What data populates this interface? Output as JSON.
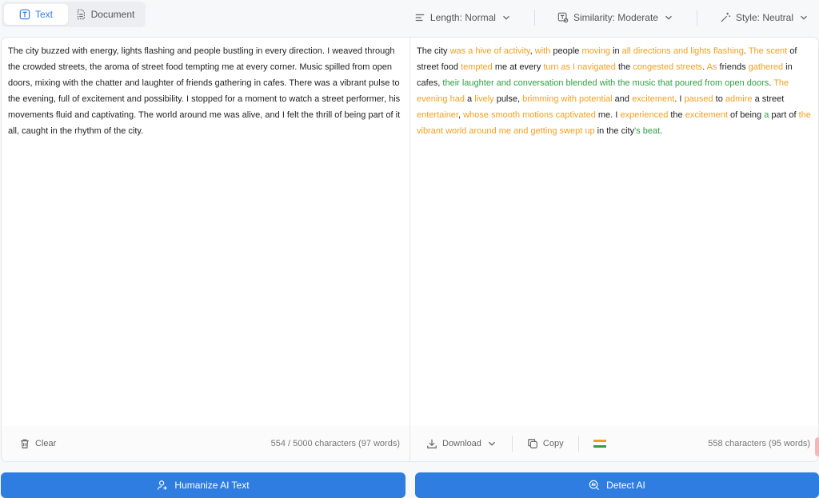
{
  "tabs": [
    {
      "label": "Text",
      "icon": "text-icon",
      "active": true
    },
    {
      "label": "Document",
      "icon": "document-icon",
      "active": false
    }
  ],
  "settings": {
    "length": "Length: Normal",
    "similarity": "Similarity: Moderate",
    "style": "Style: Neutral"
  },
  "input": {
    "text": "The city buzzed with energy, lights flashing and people bustling in every direction. I weaved through the crowded streets, the aroma of street food tempting me at every corner. Music spilled from open doors, mixing with the chatter and laughter of friends gathering in cafes. There was a vibrant pulse to the evening, full of excitement and possibility. I stopped for a moment to watch a street performer, his movements fluid and captivating. The world around me was alive, and I felt the thrill of being part of it all, caught in the rhythm of the city.",
    "clear_label": "Clear",
    "count": "554 / 5000 characters (97 words)"
  },
  "output": {
    "segments": [
      {
        "t": "The city ",
        "c": "plain"
      },
      {
        "t": "was a hive of activity",
        "c": "orange"
      },
      {
        "t": ", ",
        "c": "plain"
      },
      {
        "t": "with",
        "c": "orange"
      },
      {
        "t": " people ",
        "c": "plain"
      },
      {
        "t": "moving",
        "c": "orange"
      },
      {
        "t": " in ",
        "c": "plain"
      },
      {
        "t": "all directions and lights flashing",
        "c": "orange"
      },
      {
        "t": ". ",
        "c": "plain"
      },
      {
        "t": "The scent",
        "c": "orange"
      },
      {
        "t": " of street food ",
        "c": "plain"
      },
      {
        "t": "tempted",
        "c": "orange"
      },
      {
        "t": " me at every ",
        "c": "plain"
      },
      {
        "t": "turn as I navigated",
        "c": "orange"
      },
      {
        "t": " the ",
        "c": "plain"
      },
      {
        "t": "congested streets",
        "c": "orange"
      },
      {
        "t": ". ",
        "c": "plain"
      },
      {
        "t": "As",
        "c": "orange"
      },
      {
        "t": " friends ",
        "c": "plain"
      },
      {
        "t": "gathered",
        "c": "orange"
      },
      {
        "t": " in cafes, ",
        "c": "plain"
      },
      {
        "t": "their laughter and conversation blended with the music that poured from open doors",
        "c": "green"
      },
      {
        "t": ". ",
        "c": "plain"
      },
      {
        "t": "The evening had",
        "c": "orange"
      },
      {
        "t": " a ",
        "c": "plain"
      },
      {
        "t": "lively",
        "c": "orange"
      },
      {
        "t": " pulse, ",
        "c": "plain"
      },
      {
        "t": "brimming with potential",
        "c": "orange"
      },
      {
        "t": " and ",
        "c": "plain"
      },
      {
        "t": "excitement",
        "c": "orange"
      },
      {
        "t": ". I ",
        "c": "plain"
      },
      {
        "t": "paused",
        "c": "orange"
      },
      {
        "t": " to ",
        "c": "plain"
      },
      {
        "t": "admire",
        "c": "orange"
      },
      {
        "t": " a street ",
        "c": "plain"
      },
      {
        "t": "entertainer",
        "c": "orange"
      },
      {
        "t": ", ",
        "c": "plain"
      },
      {
        "t": "whose smooth motions captivated",
        "c": "orange"
      },
      {
        "t": " me. I ",
        "c": "plain"
      },
      {
        "t": "experienced",
        "c": "orange"
      },
      {
        "t": " the ",
        "c": "plain"
      },
      {
        "t": "excitement",
        "c": "orange"
      },
      {
        "t": " of being ",
        "c": "plain"
      },
      {
        "t": "a",
        "c": "green"
      },
      {
        "t": " part of ",
        "c": "plain"
      },
      {
        "t": "the vibrant world around me and getting swept up",
        "c": "orange"
      },
      {
        "t": " in the city",
        "c": "plain"
      },
      {
        "t": "'s beat",
        "c": "green"
      },
      {
        "t": ".",
        "c": "plain"
      }
    ],
    "download_label": "Download",
    "copy_label": "Copy",
    "count": "558 characters (95 words)"
  },
  "actions": {
    "humanize_label": "Humanize AI Text",
    "detect_label": "Detect AI"
  },
  "colors": {
    "accent": "#2f7de1",
    "changed": "#f0a020",
    "rewritten": "#2ea043"
  }
}
